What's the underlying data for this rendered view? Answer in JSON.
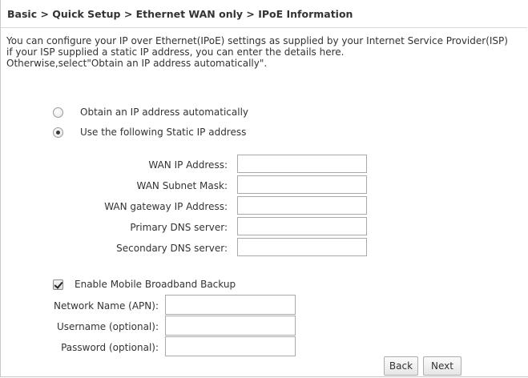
{
  "breadcrumb": "Basic > Quick Setup > Ethernet WAN only > IPoE Information",
  "description": {
    "line1": "You can configure your IP over Ethernet(IPoE) settings as supplied by your Internet Service Provider(ISP)",
    "line2": "if your ISP supplied a static IP address, you can enter the details here.",
    "line3": "Otherwise,select\"Obtain an IP address automatically\"."
  },
  "ip_mode": {
    "selected": "static",
    "auto_label": "Obtain an IP address automatically",
    "static_label": "Use the following Static IP address"
  },
  "static_fields": {
    "wan_ip_label": "WAN IP Address:",
    "wan_ip_value": "",
    "subnet_label": "WAN Subnet Mask:",
    "subnet_value": "",
    "gateway_label": "WAN gateway IP Address:",
    "gateway_value": "",
    "dns1_label": "Primary DNS server:",
    "dns1_value": "",
    "dns2_label": "Secondary DNS server:",
    "dns2_value": ""
  },
  "mobile_backup": {
    "enabled": true,
    "label": "Enable Mobile Broadband Backup",
    "apn_label": "Network Name (APN):",
    "apn_value": "",
    "username_label": "Username (optional):",
    "username_value": "",
    "password_label": "Password (optional):",
    "password_value": ""
  },
  "buttons": {
    "back": "Back",
    "next": "Next"
  }
}
